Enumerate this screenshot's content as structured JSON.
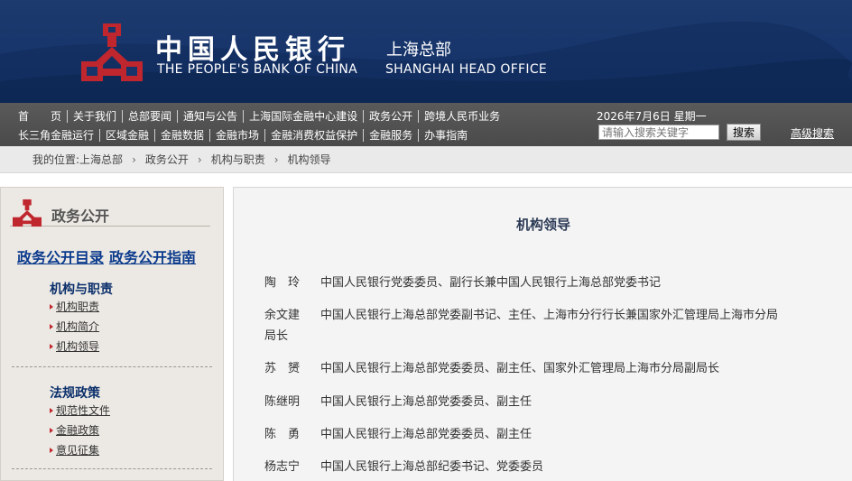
{
  "header": {
    "cn_name": "中国人民银行",
    "cn_sub": "上海总部",
    "en_name": "THE PEOPLE'S BANK OF CHINA",
    "en_sub": "SHANGHAI HEAD OFFICE"
  },
  "nav": {
    "row1": [
      "首　　页",
      "关于我们",
      "总部要闻",
      "通知与公告",
      "上海国际金融中心建设",
      "政务公开",
      "跨境人民币业务"
    ],
    "row2": [
      "长三角金融运行",
      "区域金融",
      "金融数据",
      "金融市场",
      "金融消费权益保护",
      "金融服务",
      "办事指南"
    ],
    "date": "2026年7月6日  星期一",
    "search_placeholder": "请输入搜索关键字",
    "search_button": "搜索",
    "advanced_search": "高级搜索"
  },
  "breadcrumb": {
    "prefix": "我的位置: ",
    "items": [
      "上海总部",
      "政务公开",
      "机构与职责",
      "机构领导"
    ],
    "separator": "›"
  },
  "sidebar": {
    "title": "政务公开",
    "links": [
      "政务公开目录",
      "政务公开指南"
    ],
    "sections": [
      {
        "title": "机构与职责",
        "items": [
          "机构职责",
          "机构简介",
          "机构领导"
        ]
      },
      {
        "title": "法规政策",
        "items": [
          "规范性文件",
          "金融政策",
          "意见征集"
        ]
      }
    ]
  },
  "main": {
    "title": "机构领导",
    "leaders": [
      {
        "name": "陶　玲",
        "role": "中国人民银行党委委员、副行长兼中国人民银行上海总部党委书记"
      },
      {
        "name": "余文建",
        "role": "中国人民银行上海总部党委副书记、主任、上海市分行行长兼国家外汇管理局上海市分局",
        "role_cont": "局长"
      },
      {
        "name": "苏　赟",
        "role": "中国人民银行上海总部党委委员、副主任、国家外汇管理局上海市分局副局长"
      },
      {
        "name": "陈继明",
        "role": "中国人民银行上海总部党委委员、副主任"
      },
      {
        "name": "陈　勇",
        "role": "中国人民银行上海总部党委委员、副主任"
      },
      {
        "name": "杨志宁",
        "role": "中国人民银行上海总部纪委书记、党委委员"
      }
    ]
  },
  "colors": {
    "header_bg": "#17356b",
    "nav_bg": "#4f4f4f",
    "emblem_red": "#c0262d",
    "sidebar_bg": "#ece9e4",
    "link_blue": "#0b3a8c"
  }
}
